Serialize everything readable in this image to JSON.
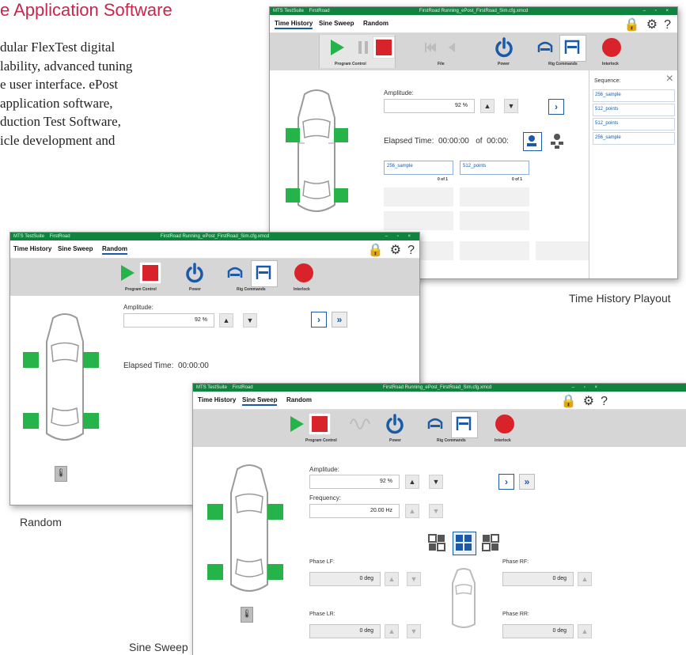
{
  "page": {
    "title": "e Application Software",
    "body_lines": [
      "dular FlexTest digital",
      "lability, advanced tuning",
      "e user interface. ePost",
      "application software,",
      "duction Test Software,",
      "icle development and"
    ],
    "captions": {
      "time_history": "Time History Playout",
      "random": "Random",
      "sine_sweep": "Sine Sweep"
    }
  },
  "colors": {
    "accent": "#c8264d",
    "titlebar": "#10843f",
    "actuator": "#25b34a",
    "stop": "#d9232b",
    "power": "#1a5aa8"
  },
  "app": {
    "brand": "MTS TestSuite",
    "station": "FirstRoad",
    "tabs": [
      "Time History",
      "Sine Sweep",
      "Random"
    ],
    "toolbar_groups": {
      "program_control": "Program Control",
      "file": "File",
      "power": "Power",
      "rig_commands": "Rig Commands",
      "interlock": "Interlock"
    },
    "header_icons": [
      "lock-icon",
      "gear-icon",
      "help-icon"
    ],
    "help_glyph": "?"
  },
  "window_time_history": {
    "doc_title": "FirstRoad Running_ePost_FirstRoad_Sim.cfg.xmcd",
    "amplitude_label": "Amplitude:",
    "amplitude_value": "92 %",
    "elapsed_label": "Elapsed Time:",
    "elapsed_value": "00:00:00",
    "of_label": "of",
    "total_value": "00:00:",
    "queue": [
      {
        "name": "256_sample",
        "count": "0 of 1"
      },
      {
        "name": "512_points",
        "count": "0 of 1"
      }
    ],
    "sequence_label": "Sequence:",
    "sequence_items": [
      "256_sample",
      "512_points",
      "512_points",
      "256_sample"
    ],
    "close_glyph": "×"
  },
  "window_random": {
    "doc_title": "FirstRoad Running_ePost_FirstRoad_Sim.cfg.xmcd",
    "amplitude_label": "Amplitude:",
    "amplitude_value": "92 %",
    "elapsed_label": "Elapsed Time:",
    "elapsed_value": "00:00:00"
  },
  "window_sine": {
    "doc_title": "FirstRoad Running_ePost_FirstRoad_Sim.cfg.xmcd",
    "amplitude_label": "Amplitude:",
    "amplitude_value": "92 %",
    "frequency_label": "Frequency:",
    "frequency_value": "20.00 Hz",
    "phase_lf_label": "Phase LF:",
    "phase_rf_label": "Phase RF:",
    "phase_lr_label": "Phase LR:",
    "phase_rr_label": "Phase RR:",
    "phase_value": "0 deg"
  }
}
